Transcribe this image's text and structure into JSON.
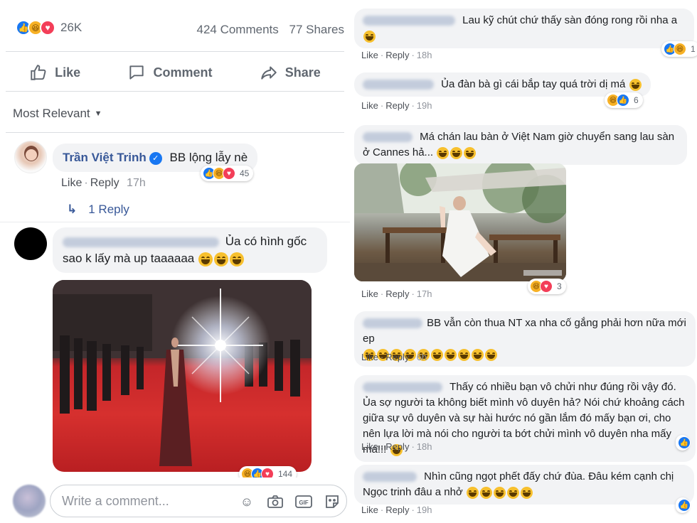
{
  "left": {
    "reaction_count": "26K",
    "comments": "424 Comments",
    "shares": "77 Shares",
    "actions": {
      "like": "Like",
      "comment": "Comment",
      "share": "Share"
    },
    "sort": "Most Relevant",
    "comments_list": [
      {
        "author": "Trần Việt Trinh",
        "text": "BB lộng lẫy nè",
        "like": "Like",
        "reply": "Reply",
        "time": "17h",
        "reactions": "45",
        "replies": "1 Reply"
      },
      {
        "text": "Ủa có hình gốc sao k lấy mà up taaaaaa",
        "reactions_count": "144"
      }
    ],
    "composer_placeholder": "Write a comment...",
    "composer_icons": [
      "smiley-icon",
      "camera-icon",
      "gif-icon",
      "sticker-icon"
    ]
  },
  "right": {
    "comments": [
      {
        "text": "Lau kỹ chút chứ thấy sàn đóng rong rồi nha a",
        "time": "18h",
        "reactions": "1"
      },
      {
        "text": "Ủa đàn bà gì cái bắp tay quá trời dị má",
        "time": "19h",
        "reactions": "6"
      },
      {
        "text": "Má chán lau bàn ở Việt Nam giờ chuyển sang lau sàn ở Cannes hả...",
        "time": "17h",
        "reactions": "3"
      },
      {
        "text": "BB vẫn còn thua NT xa nha cố gắng phải hơn nữa mới ep",
        "time": "6h"
      },
      {
        "text": "Thấy có nhiều bạn vô chửi như đúng rồi vậy đó. Ủa sợ người ta không biết mình vô duyên hả? Nói chứ khoảng cách giữa sự vô duyên và sự hài hước nó gần lắm đó mấy bạn ơi, cho nên lựa lời mà nói cho người ta bớt chửi mình vô duyên nha mấy má!!!",
        "time": "18h"
      },
      {
        "text": "Nhìn cũng ngọt phết đấy chứ đùa. Đâu kém cạnh chị Ngọc trinh đâu a nhở",
        "time": "19h"
      }
    ],
    "like": "Like",
    "reply": "Reply"
  }
}
